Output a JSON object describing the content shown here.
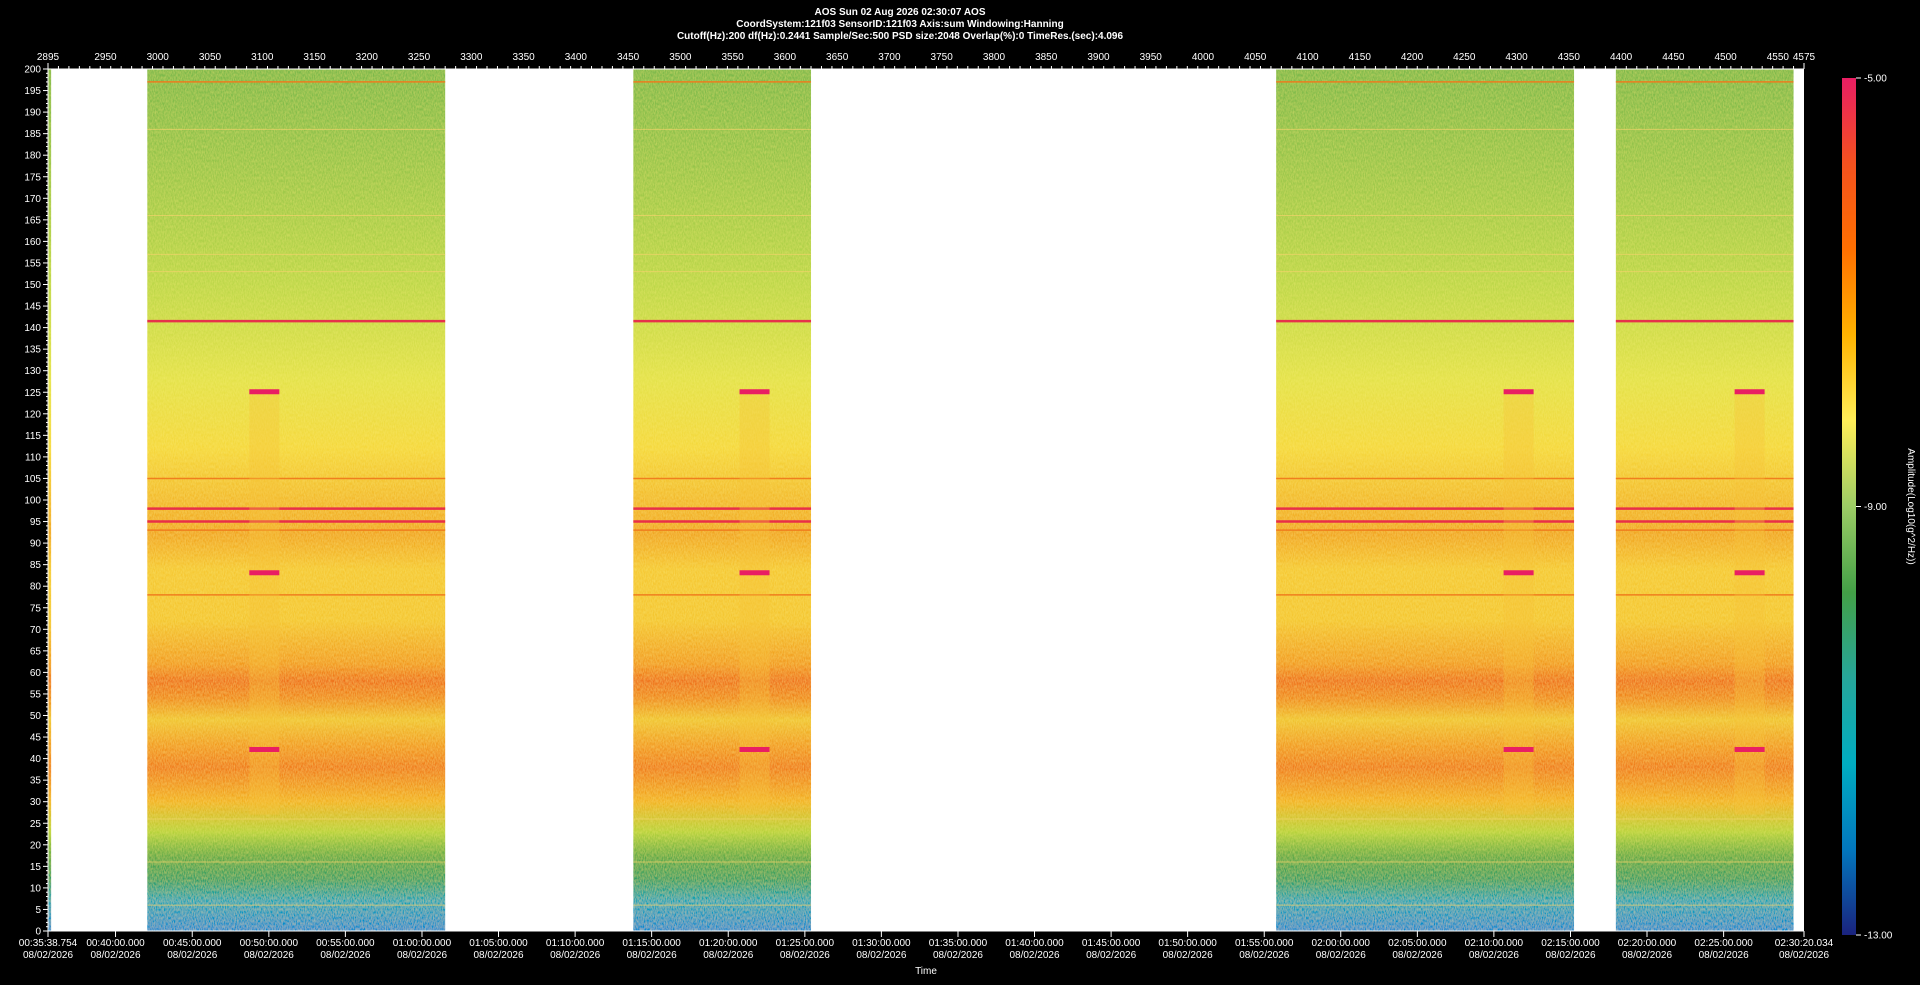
{
  "header": {
    "line1": "AOS  Sun 02 Aug 2026 02:30:07  AOS",
    "line2": "CoordSystem:121f03   SensorID:121f03   Axis:sum    Windowing:Hanning",
    "line3": "Cutoff(Hz):200      df(Hz):0.2441      Sample/Sec:500      PSD size:2048      Overlap(%):0      TimeRes.(sec):4.096"
  },
  "chart_data": {
    "type": "heatmap",
    "top_axis_ticks": [
      "2895",
      "2950",
      "3000",
      "3050",
      "3100",
      "3150",
      "3200",
      "3250",
      "3300",
      "3350",
      "3400",
      "3450",
      "3500",
      "3550",
      "3600",
      "3650",
      "3700",
      "3750",
      "3800",
      "3850",
      "3900",
      "3950",
      "4000",
      "4050",
      "4100",
      "4150",
      "4200",
      "4250",
      "4300",
      "4350",
      "4400",
      "4450",
      "4500",
      "4550",
      "4575"
    ],
    "top_axis_values": [
      2895,
      2950,
      3000,
      3050,
      3100,
      3150,
      3200,
      3250,
      3300,
      3350,
      3400,
      3450,
      3500,
      3550,
      3600,
      3650,
      3700,
      3750,
      3800,
      3850,
      3900,
      3950,
      4000,
      4050,
      4100,
      4150,
      4200,
      4250,
      4300,
      4350,
      4400,
      4450,
      4500,
      4550,
      4575
    ],
    "top_axis_range": [
      2895,
      4575
    ],
    "y_ticks": [
      0,
      5,
      10,
      15,
      20,
      25,
      30,
      35,
      40,
      45,
      50,
      55,
      60,
      65,
      70,
      75,
      80,
      85,
      90,
      95,
      100,
      105,
      110,
      115,
      120,
      125,
      130,
      135,
      140,
      145,
      150,
      155,
      160,
      165,
      170,
      175,
      180,
      185,
      190,
      195,
      200
    ],
    "ylim": [
      0,
      200
    ],
    "xlabel": "Time",
    "bottom_ticks": [
      {
        "v": 2895,
        "time": "00:35:38.754",
        "date": "08/02/2026"
      },
      {
        "v": 2959.6,
        "time": "00:40:00.000",
        "date": "08/02/2026"
      },
      {
        "v": 3033,
        "time": "00:45:00.000",
        "date": "08/02/2026"
      },
      {
        "v": 3106.3,
        "time": "00:50:00.000",
        "date": "08/02/2026"
      },
      {
        "v": 3179.5,
        "time": "00:55:00.000",
        "date": "08/02/2026"
      },
      {
        "v": 3252.8,
        "time": "01:00:00.000",
        "date": "08/02/2026"
      },
      {
        "v": 3326,
        "time": "01:05:00.000",
        "date": "08/02/2026"
      },
      {
        "v": 3399.3,
        "time": "01:10:00.000",
        "date": "08/02/2026"
      },
      {
        "v": 3472.5,
        "time": "01:15:00.000",
        "date": "08/02/2026"
      },
      {
        "v": 3545.8,
        "time": "01:20:00.000",
        "date": "08/02/2026"
      },
      {
        "v": 3619.1,
        "time": "01:25:00.000",
        "date": "08/02/2026"
      },
      {
        "v": 3692.3,
        "time": "01:30:00.000",
        "date": "08/02/2026"
      },
      {
        "v": 3765.6,
        "time": "01:35:00.000",
        "date": "08/02/2026"
      },
      {
        "v": 3838.8,
        "time": "01:40:00.000",
        "date": "08/02/2026"
      },
      {
        "v": 3912.1,
        "time": "01:45:00.000",
        "date": "08/02/2026"
      },
      {
        "v": 3985.3,
        "time": "01:50:00.000",
        "date": "08/02/2026"
      },
      {
        "v": 4058.6,
        "time": "01:55:00.000",
        "date": "08/02/2026"
      },
      {
        "v": 4131.8,
        "time": "02:00:00.000",
        "date": "08/02/2026"
      },
      {
        "v": 4205.1,
        "time": "02:05:00.000",
        "date": "08/02/2026"
      },
      {
        "v": 4278.3,
        "time": "02:10:00.000",
        "date": "08/02/2026"
      },
      {
        "v": 4351.6,
        "time": "02:15:00.000",
        "date": "08/02/2026"
      },
      {
        "v": 4424.8,
        "time": "02:20:00.000",
        "date": "08/02/2026"
      },
      {
        "v": 4498.1,
        "time": "02:25:00.000",
        "date": "08/02/2026"
      },
      {
        "v": 4575,
        "time": "02:30:20.034",
        "date": "08/02/2026"
      }
    ],
    "data_segments": [
      [
        2895,
        2898
      ],
      [
        2990,
        3275
      ],
      [
        3455,
        3625
      ],
      [
        4070,
        4355
      ],
      [
        4395,
        4565
      ]
    ],
    "spectral_lines_hz": [
      {
        "hz": 197,
        "level": "orange"
      },
      {
        "hz": 186,
        "level": "faint"
      },
      {
        "hz": 166,
        "level": "faint"
      },
      {
        "hz": 157,
        "level": "faint"
      },
      {
        "hz": 153,
        "level": "faint"
      },
      {
        "hz": 141.5,
        "level": "red"
      },
      {
        "hz": 105,
        "level": "orange"
      },
      {
        "hz": 98,
        "level": "red"
      },
      {
        "hz": 95,
        "level": "red"
      },
      {
        "hz": 93,
        "level": "orange"
      },
      {
        "hz": 78,
        "level": "orange"
      },
      {
        "hz": 26,
        "level": "faint"
      },
      {
        "hz": 16,
        "level": "faint"
      },
      {
        "hz": 6,
        "level": "faint"
      }
    ],
    "broadband_events_at": [
      3101,
      3570,
      4301,
      4522
    ],
    "colorbar": {
      "label": "Amplitude(Log10(g^2/Hz))",
      "ticks": [
        "-5.00",
        "-9.00",
        "-13.00"
      ],
      "range": [
        -13,
        -5
      ],
      "colors": [
        "#1a237e",
        "#0277bd",
        "#00acc1",
        "#26a69a",
        "#43a047",
        "#9ccc65",
        "#ffee58",
        "#ffb300",
        "#ff6f00",
        "#f4511e",
        "#e91e63"
      ]
    }
  }
}
